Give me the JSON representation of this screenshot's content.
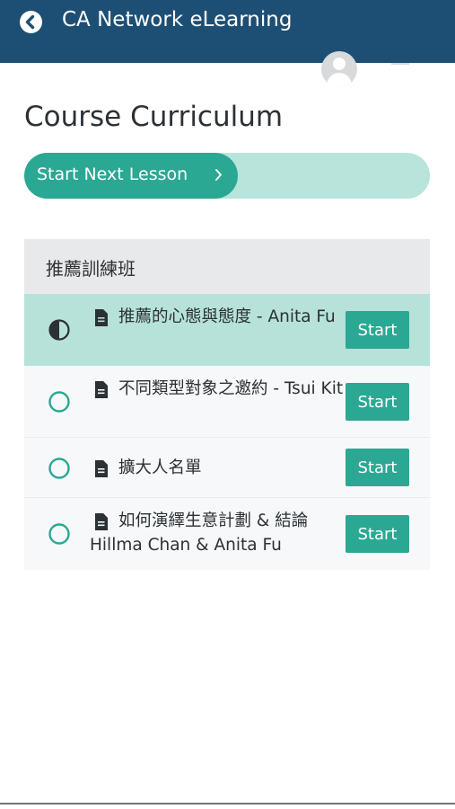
{
  "header": {
    "app_title": "CA Network eLearning",
    "back_icon": "chevron-left-circle",
    "avatar_icon": "user-avatar",
    "menu_icon": "hamburger-menu"
  },
  "main": {
    "page_title": "Course Curriculum",
    "next_lesson_label": "Start Next Lesson",
    "next_lesson_icon": "chevron-right"
  },
  "section": {
    "title": "推薦訓練班",
    "lessons": [
      {
        "title": "推薦的心態與態度 - Anita Fu",
        "status": "in-progress",
        "type_icon": "document",
        "button": "Start"
      },
      {
        "title": "不同類型對象之邀約 - Tsui Kit",
        "status": "not-started",
        "type_icon": "document",
        "button": "Start"
      },
      {
        "title": "擴大人名單",
        "status": "not-started",
        "type_icon": "document",
        "button": "Start"
      },
      {
        "title": "如何演繹生意計劃 & 結論 Hillma Chan & Anita Fu",
        "status": "not-started",
        "type_icon": "document",
        "button": "Start"
      }
    ]
  },
  "colors": {
    "header_bg": "#1d4f75",
    "accent": "#2aa893",
    "accent_light": "#b8e4db",
    "active_row": "#b6e2da"
  }
}
